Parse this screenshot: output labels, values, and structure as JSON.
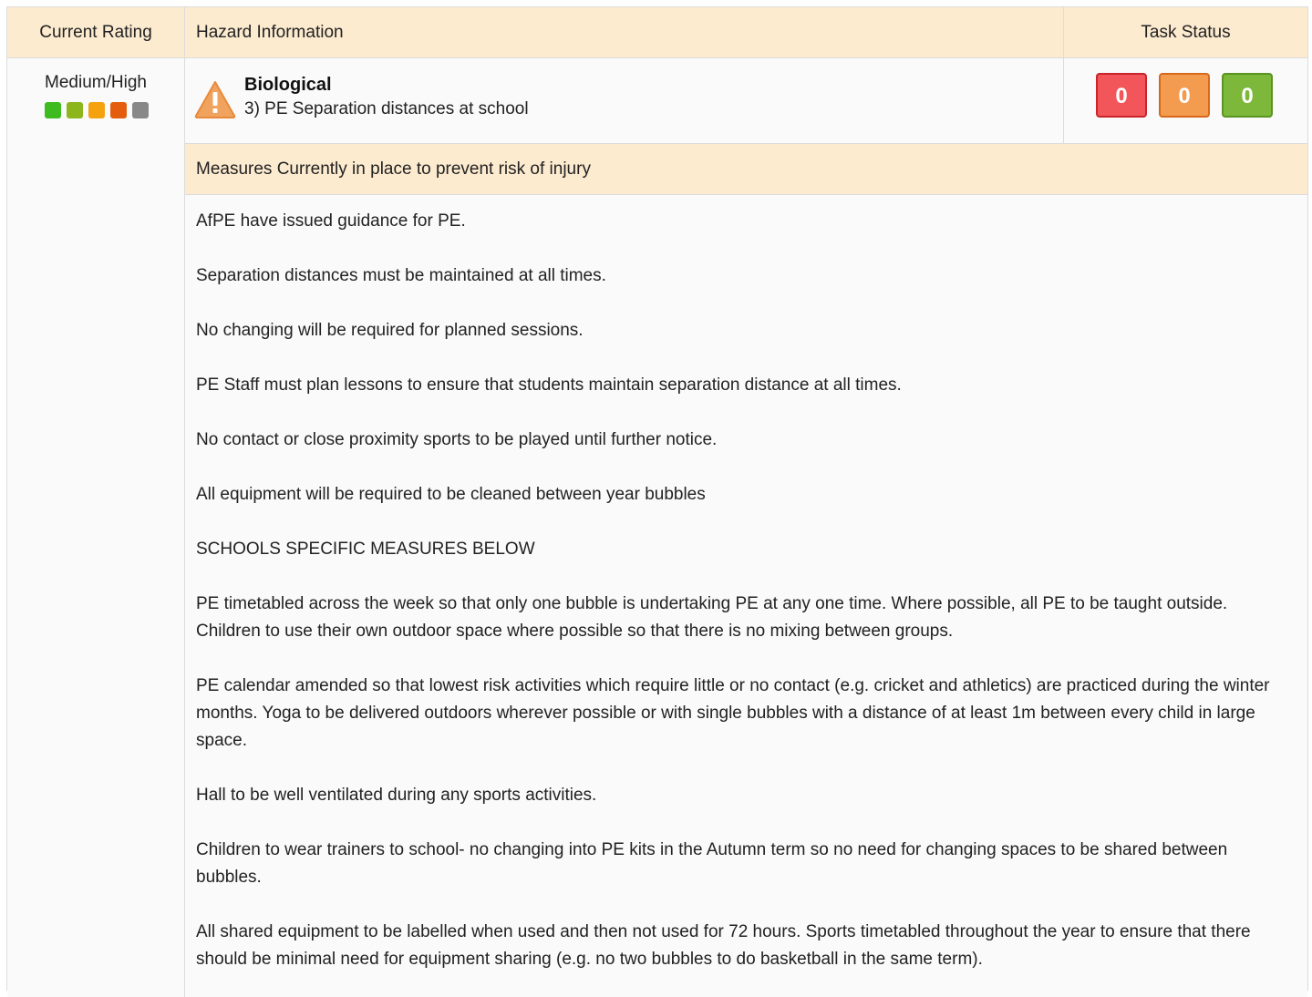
{
  "headers": {
    "current_rating": "Current Rating",
    "hazard_information": "Hazard Information",
    "task_status": "Task Status"
  },
  "rating": {
    "label": "Medium/High",
    "scale_colors": [
      "#3dbb1f",
      "#8db51c",
      "#f5a20f",
      "#e45d0c",
      "#888888"
    ]
  },
  "hazard": {
    "icon": "warning-triangle-icon",
    "category": "Biological",
    "title": "3) PE Separation distances at school"
  },
  "task_status": {
    "red_count": "0",
    "orange_count": "0",
    "green_count": "0"
  },
  "measures": {
    "header": "Measures Currently in place to prevent risk of injury",
    "items": [
      "AfPE have issued guidance for PE.",
      "Separation distances must be maintained at all times.",
      "No changing will be required for planned sessions.",
      "PE Staff must plan lessons to ensure that students maintain separation distance at all times.",
      "No contact or close proximity sports to be played until further notice.",
      "All equipment will be required to be cleaned between year bubbles",
      "SCHOOLS SPECIFIC MEASURES BELOW",
      "PE timetabled across the week so that only one bubble is undertaking PE at any one time. Where possible, all PE to be taught outside. Children to use their own outdoor space where possible so that there is no mixing between groups.",
      "PE calendar amended so that lowest risk activities which require little or no contact (e.g. cricket and athletics) are practiced during the winter months. Yoga to be delivered outdoors wherever possible or with single bubbles with a distance of at least 1m between every child in large space.",
      "Hall to be well ventilated during any sports activities.",
      "Children to wear trainers to school- no changing into PE kits in the Autumn term so no need for changing spaces to be shared between bubbles.",
      "All shared equipment to be labelled when used and then not used for 72 hours. Sports timetabled throughout the year to ensure that there should be minimal need for equipment sharing (e.g. no two bubbles to do basketball in the same term)."
    ]
  }
}
